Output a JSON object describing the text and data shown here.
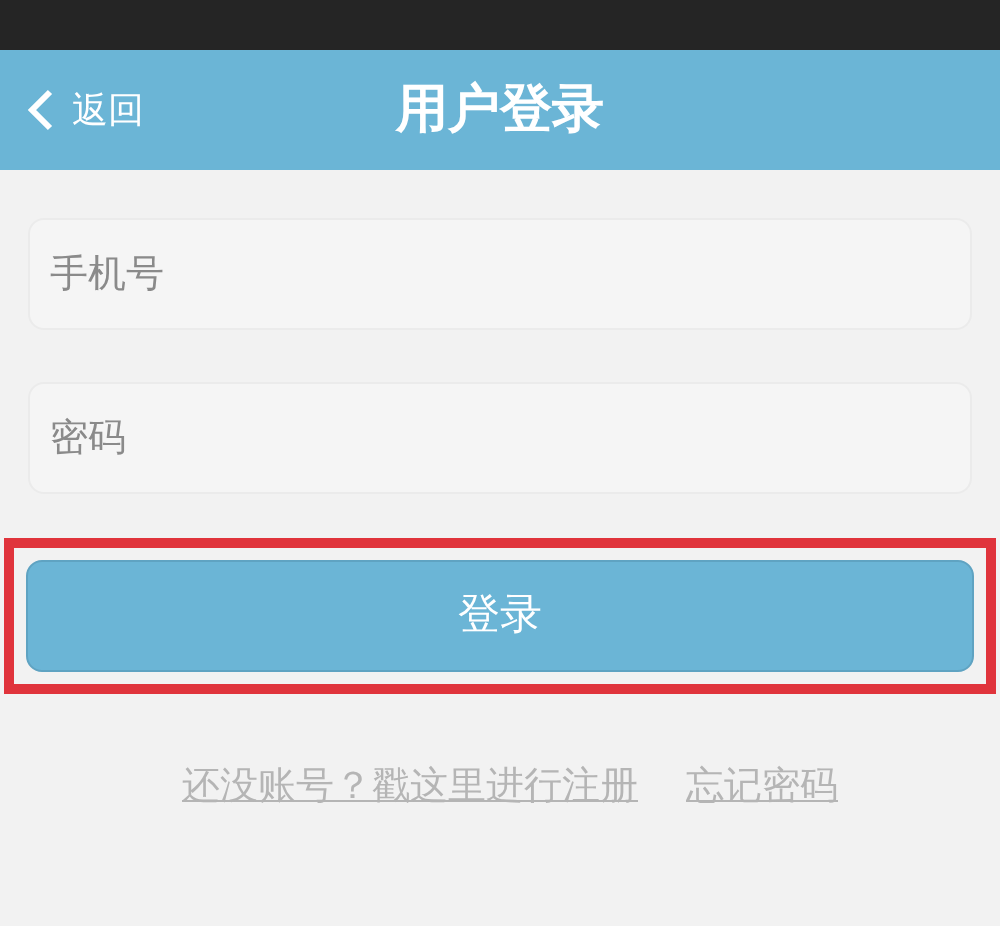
{
  "nav_bar": {
    "back_label": "返回",
    "title": "用户登录"
  },
  "fields": [
    {
      "placeholder": "手机号"
    },
    {
      "placeholder": "密码"
    }
  ],
  "login_button": {
    "label": "登录",
    "highlighted": true
  },
  "links": [
    {
      "label": "还没账号？戳这里进行注册"
    },
    {
      "label": "忘记密码"
    }
  ]
}
